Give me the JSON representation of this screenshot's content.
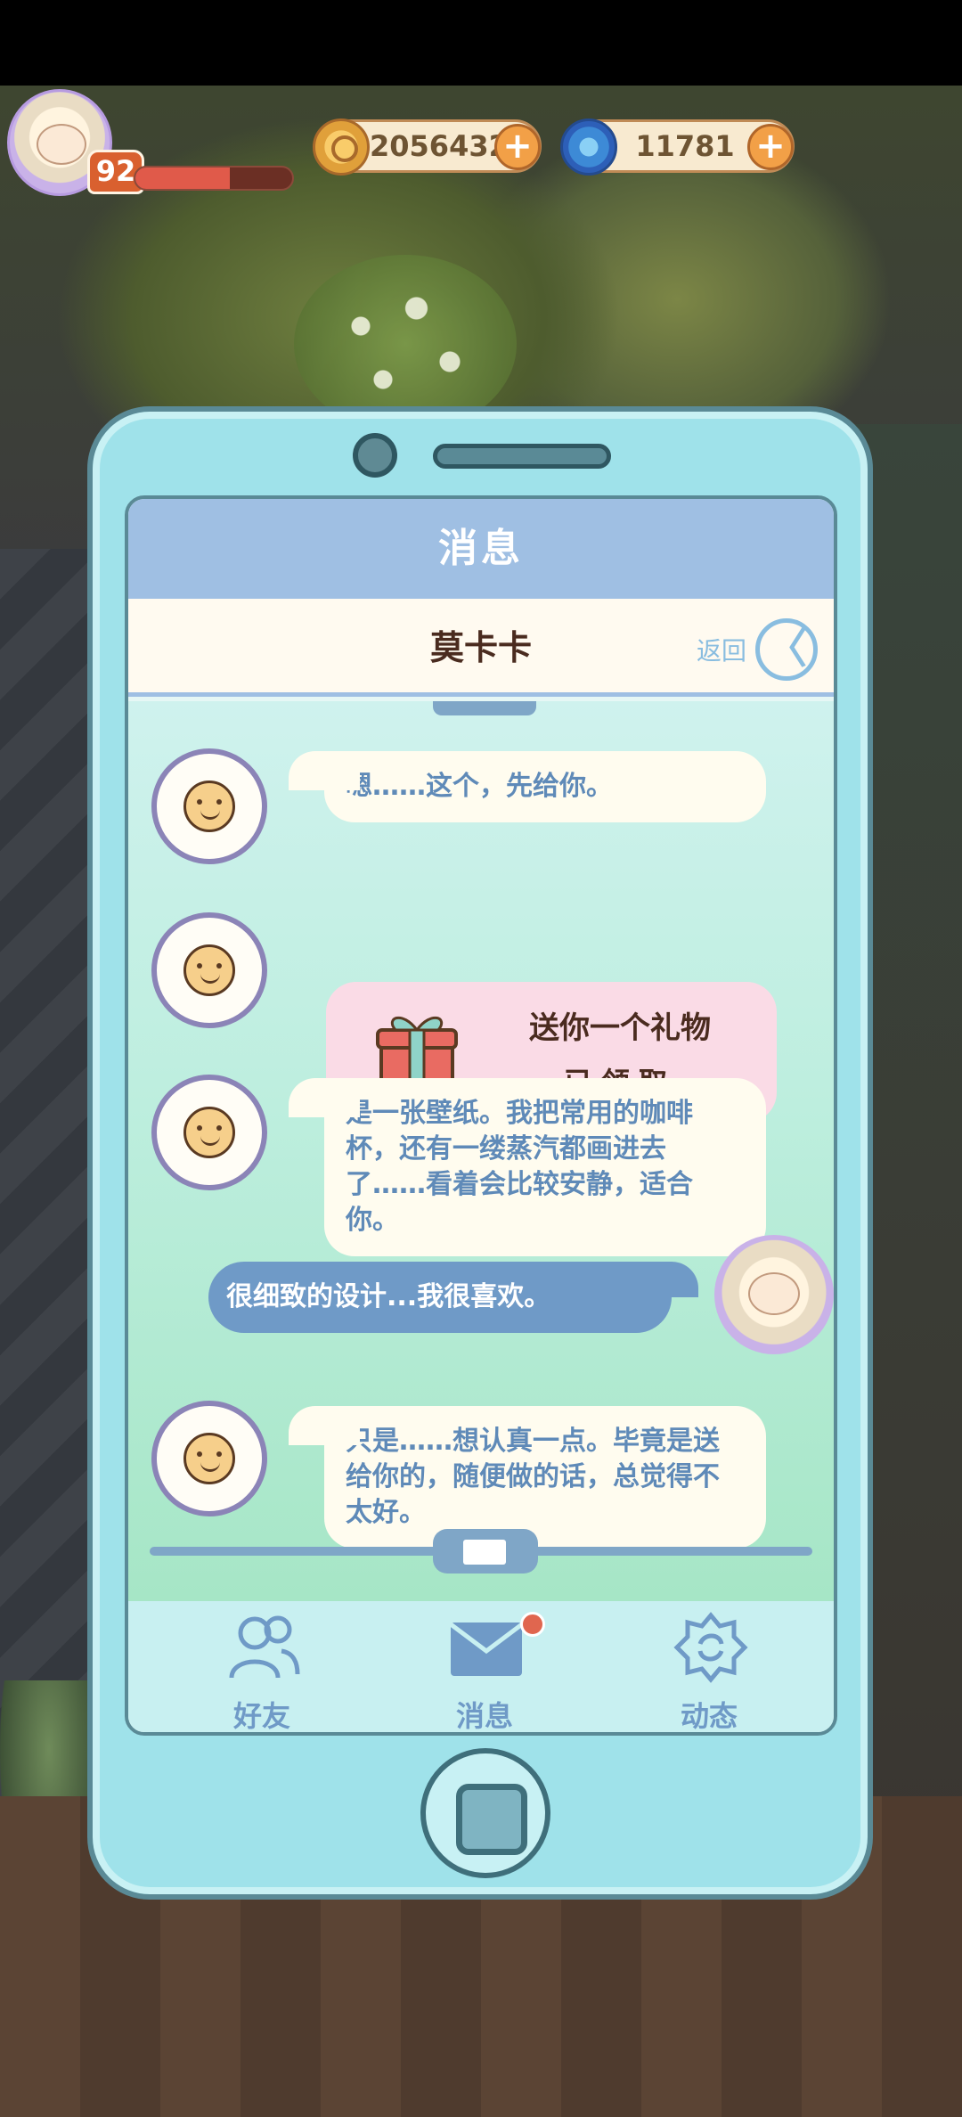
{
  "hud": {
    "level": "92",
    "xp_fraction": 0.6,
    "coins": "2056432",
    "gems": "11781",
    "plus_symbol": "+"
  },
  "phone": {
    "screen_title": "消息",
    "chat_partner": "莫卡卡",
    "back_label": "返回",
    "back_symbol": "〈",
    "messages": [
      {
        "from": "partner",
        "text": "嗯……这个，先给你。"
      },
      {
        "from": "partner",
        "type": "gift",
        "title": "送你一个礼物",
        "status": "已领取"
      },
      {
        "from": "partner",
        "text": "是一张壁纸。我把常用的咖啡杯，还有一缕蒸汽都画进去了……看着会比较安静，适合你。"
      },
      {
        "from": "player",
        "text": "很细致的设计...我很喜欢。"
      },
      {
        "from": "partner",
        "text": "只是……想认真一点。毕竟是送给你的，随便做的话，总觉得不太好。"
      }
    ],
    "nav": [
      {
        "label": "好友",
        "icon": "friends-icon"
      },
      {
        "label": "消息",
        "icon": "mail-icon",
        "has_notification": true
      },
      {
        "label": "动态",
        "icon": "moments-icon"
      }
    ]
  },
  "colors": {
    "phone_body": "#9fe2ea",
    "title_bar": "#9fbfe3",
    "partner_text": "#5f8ab8",
    "player_bubble": "#6f9ac7",
    "gift_card": "#fadbe6",
    "notification": "#e0664f"
  }
}
